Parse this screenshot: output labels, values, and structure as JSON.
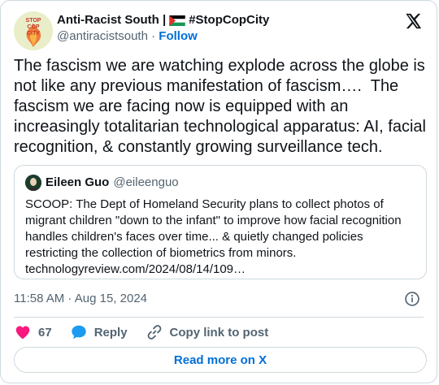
{
  "author": {
    "display_name": "Anti-Racist South |",
    "hashtag": "#StopCopCity",
    "handle": "@antiracistsouth",
    "separator": "·",
    "follow_label": "Follow",
    "avatar_text": [
      "STOP",
      "COP",
      "CITY"
    ]
  },
  "tweet": {
    "text": "The fascism we are watching explode across the globe is not like any previous manifestation of fascism….  The fascism we are facing now is equipped with an increasingly totalitarian technological apparatus: AI, facial recognition, & constantly growing surveillance tech."
  },
  "quoted_tweet": {
    "display_name": "Eileen Guo",
    "handle": "@eileenguo",
    "text": "SCOOP: The Dept of Homeland Security plans to collect photos of migrant children \"down to the infant\" to improve how facial recognition handles children's faces over time... & quietly changed policies restricting the collection of biometrics from minors.\ntechnologyreview.com/2024/08/14/109…"
  },
  "meta": {
    "timestamp": "11:58 AM · Aug 15, 2024"
  },
  "actions": {
    "like_count": "67",
    "reply_label": "Reply",
    "copy_label": "Copy link to post"
  },
  "footer": {
    "read_more_label": "Read more on X"
  },
  "colors": {
    "link_blue": "#006fd6",
    "like_red": "#f91880",
    "reply_blue": "#1d9bf0",
    "muted": "#536471",
    "border": "#cfd9de"
  },
  "icons": {
    "brand": "x-logo-icon",
    "info": "info-icon",
    "like": "heart-icon",
    "reply": "speech-bubble-icon",
    "copy": "link-icon",
    "flag": "palestine-flag-icon"
  }
}
